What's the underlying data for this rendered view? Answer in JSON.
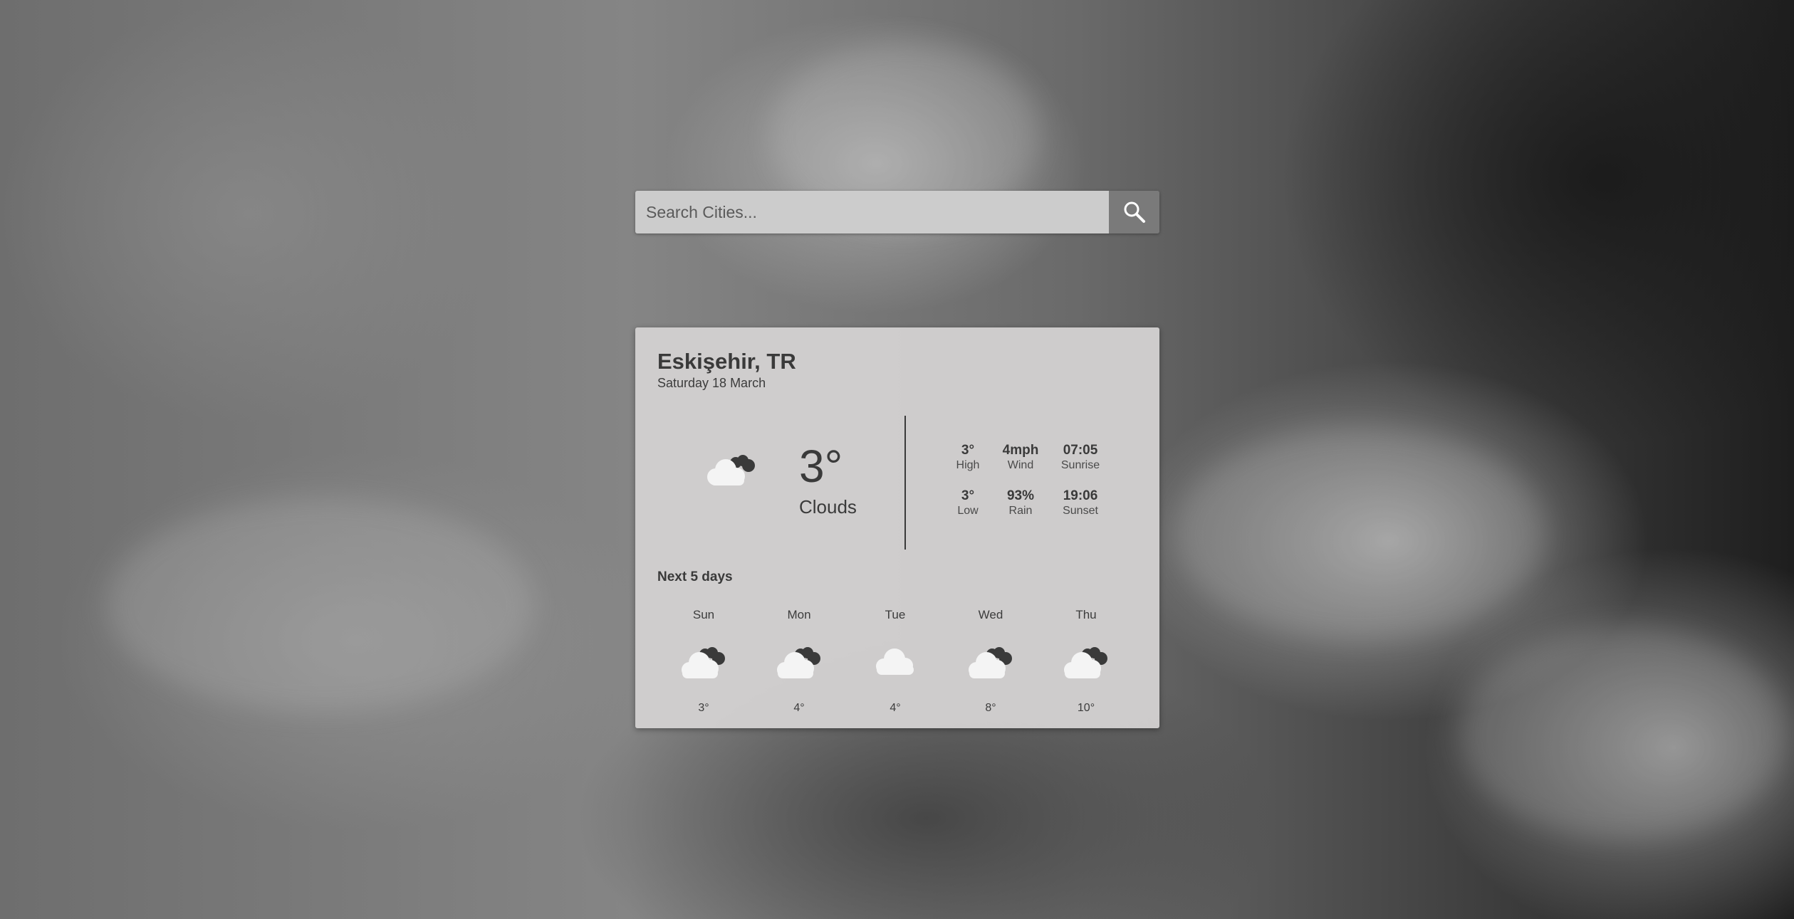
{
  "search": {
    "placeholder": "Search Cities...",
    "button_icon": "search-icon"
  },
  "current": {
    "city": "Eskişehir, TR",
    "date": "Saturday 18 March",
    "temp": "3°",
    "description": "Clouds",
    "icon": "clouds-icon"
  },
  "stats": [
    {
      "value": "3°",
      "label": "High"
    },
    {
      "value": "4mph",
      "label": "Wind"
    },
    {
      "value": "07:05",
      "label": "Sunrise"
    },
    {
      "value": "3°",
      "label": "Low"
    },
    {
      "value": "93%",
      "label": "Rain"
    },
    {
      "value": "19:06",
      "label": "Sunset"
    }
  ],
  "forecast": {
    "title": "Next 5 days",
    "days": [
      {
        "day": "Sun",
        "temp": "3°",
        "icon": "broken-clouds-icon"
      },
      {
        "day": "Mon",
        "temp": "4°",
        "icon": "broken-clouds-icon"
      },
      {
        "day": "Tue",
        "temp": "4°",
        "icon": "cloud-icon"
      },
      {
        "day": "Wed",
        "temp": "8°",
        "icon": "broken-clouds-icon"
      },
      {
        "day": "Thu",
        "temp": "10°",
        "icon": "broken-clouds-icon"
      }
    ]
  },
  "colors": {
    "card_bg": "#d2d0d0",
    "search_button": "#7a7a7a",
    "text": "#3a3a3a"
  }
}
